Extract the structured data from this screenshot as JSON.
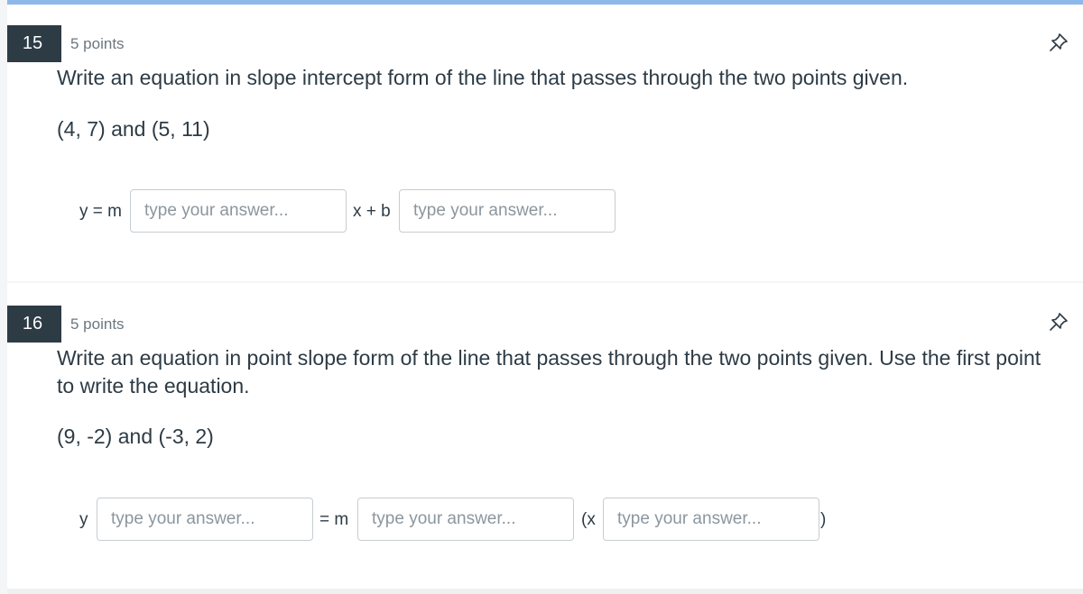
{
  "questions": [
    {
      "number": "15",
      "points": "5 points",
      "text": "Write an equation in slope intercept form of the line that passes through the two points given.",
      "given": "(4, 7) and (5, 11)",
      "labels": [
        "y = m",
        "x + b"
      ],
      "placeholder": "type your answer..."
    },
    {
      "number": "16",
      "points": "5 points",
      "text": "Write an equation in point slope form of the line that passes through the two points given. Use the first point to write the equation.",
      "given": "(9, -2) and (-3, 2)",
      "labels": [
        "y",
        "= m",
        "(x",
        ")"
      ],
      "placeholder": "type your answer..."
    }
  ],
  "icons": {
    "pin": "pin-icon"
  },
  "colors": {
    "badge": "#2d3b45",
    "accent": "#8db8ec",
    "border": "#c7cdd1"
  }
}
